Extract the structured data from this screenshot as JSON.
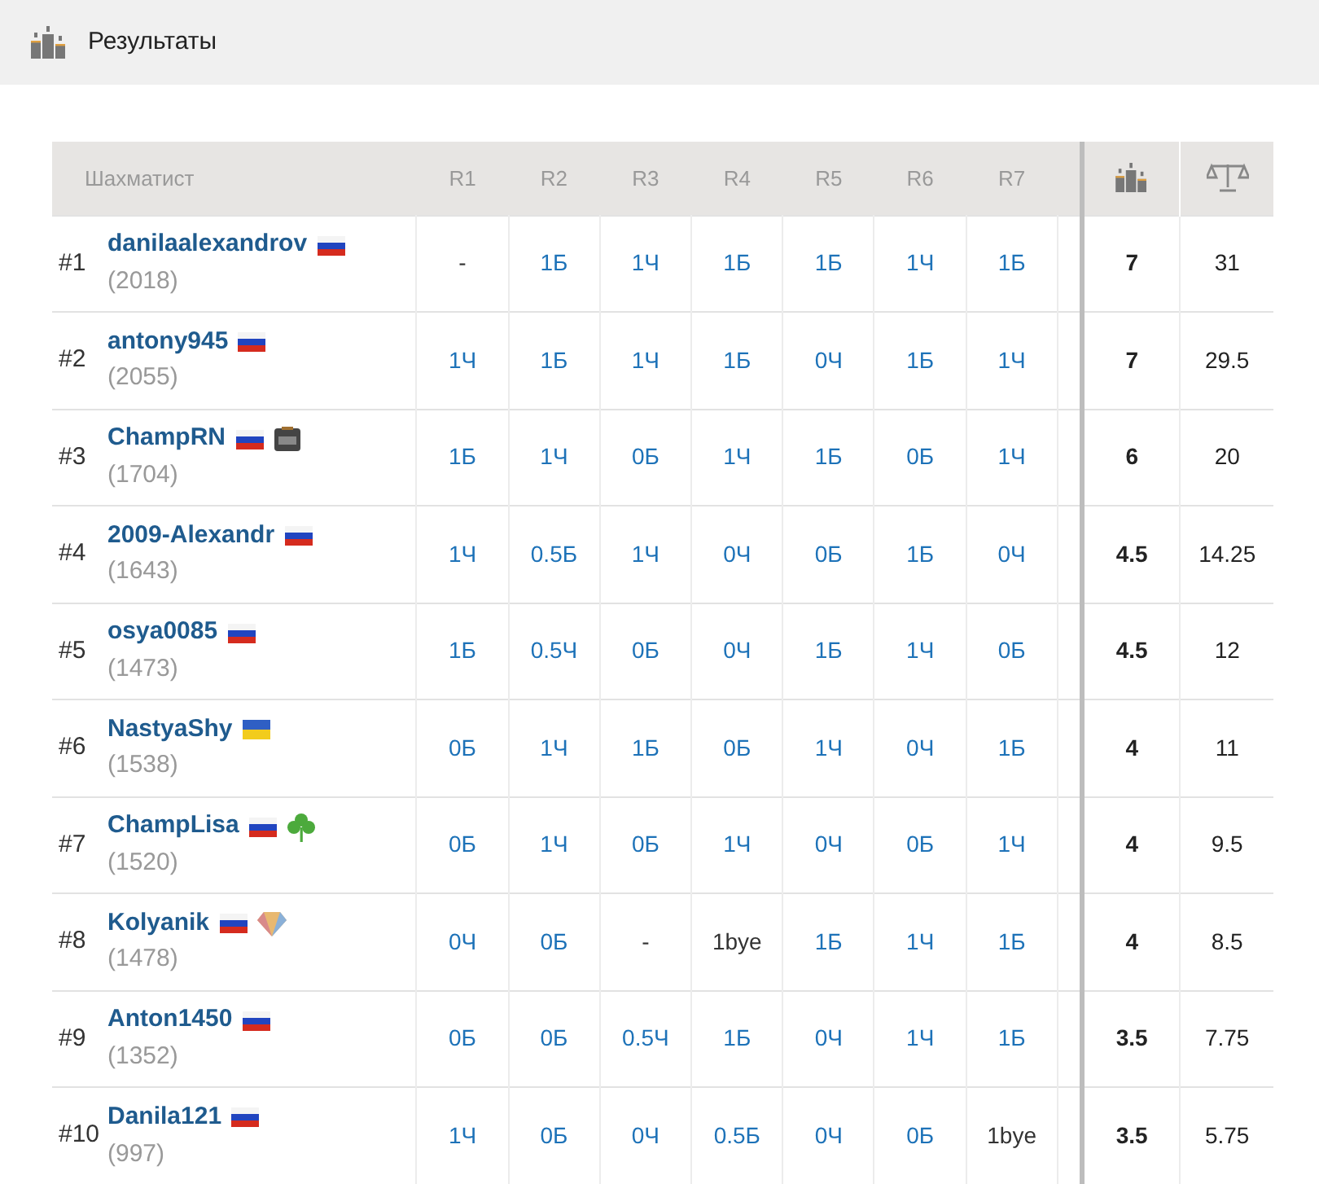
{
  "page_title": "Результаты",
  "table": {
    "columns": [
      "Шахматист",
      "R1",
      "R2",
      "R3",
      "R4",
      "R5",
      "R6",
      "R7"
    ],
    "rows": [
      {
        "rank": "#1",
        "name": "danilaalexandrov",
        "rating": "(2018)",
        "badges": [
          {
            "kind": "flag_ru"
          }
        ],
        "results": [
          {
            "text": "-",
            "kind": "plain"
          },
          {
            "text": "1Б",
            "kind": "link"
          },
          {
            "text": "1Ч",
            "kind": "link"
          },
          {
            "text": "1Б",
            "kind": "link"
          },
          {
            "text": "1Б",
            "kind": "link"
          },
          {
            "text": "1Ч",
            "kind": "link"
          },
          {
            "text": "1Б",
            "kind": "link"
          }
        ],
        "points": "7",
        "tiebreak": "31"
      },
      {
        "rank": "#2",
        "name": "antony945",
        "rating": "(2055)",
        "badges": [
          {
            "kind": "flag_ru"
          }
        ],
        "results": [
          {
            "text": "1Ч",
            "kind": "link"
          },
          {
            "text": "1Б",
            "kind": "link"
          },
          {
            "text": "1Ч",
            "kind": "link"
          },
          {
            "text": "1Б",
            "kind": "link"
          },
          {
            "text": "0Ч",
            "kind": "link"
          },
          {
            "text": "1Б",
            "kind": "link"
          },
          {
            "text": "1Ч",
            "kind": "link"
          }
        ],
        "points": "7",
        "tiebreak": "29.5"
      },
      {
        "rank": "#3",
        "name": "ChampRN",
        "rating": "(1704)",
        "badges": [
          {
            "kind": "flag_ru"
          },
          {
            "kind": "box"
          }
        ],
        "results": [
          {
            "text": "1Б",
            "kind": "link"
          },
          {
            "text": "1Ч",
            "kind": "link"
          },
          {
            "text": "0Б",
            "kind": "link"
          },
          {
            "text": "1Ч",
            "kind": "link"
          },
          {
            "text": "1Б",
            "kind": "link"
          },
          {
            "text": "0Б",
            "kind": "link"
          },
          {
            "text": "1Ч",
            "kind": "link"
          }
        ],
        "points": "6",
        "tiebreak": "20"
      },
      {
        "rank": "#4",
        "name": "2009-Alexandr",
        "rating": "(1643)",
        "badges": [
          {
            "kind": "flag_ru"
          }
        ],
        "results": [
          {
            "text": "1Ч",
            "kind": "link"
          },
          {
            "text": "0.5Б",
            "kind": "link"
          },
          {
            "text": "1Ч",
            "kind": "link"
          },
          {
            "text": "0Ч",
            "kind": "link"
          },
          {
            "text": "0Б",
            "kind": "link"
          },
          {
            "text": "1Б",
            "kind": "link"
          },
          {
            "text": "0Ч",
            "kind": "link"
          }
        ],
        "points": "4.5",
        "tiebreak": "14.25"
      },
      {
        "rank": "#5",
        "name": "osya0085",
        "rating": "(1473)",
        "badges": [
          {
            "kind": "flag_ru"
          }
        ],
        "results": [
          {
            "text": "1Б",
            "kind": "link"
          },
          {
            "text": "0.5Ч",
            "kind": "link"
          },
          {
            "text": "0Б",
            "kind": "link"
          },
          {
            "text": "0Ч",
            "kind": "link"
          },
          {
            "text": "1Б",
            "kind": "link"
          },
          {
            "text": "1Ч",
            "kind": "link"
          },
          {
            "text": "0Б",
            "kind": "link"
          }
        ],
        "points": "4.5",
        "tiebreak": "12"
      },
      {
        "rank": "#6",
        "name": "NastyaShy",
        "rating": "(1538)",
        "badges": [
          {
            "kind": "flag_ua"
          }
        ],
        "results": [
          {
            "text": "0Б",
            "kind": "link"
          },
          {
            "text": "1Ч",
            "kind": "link"
          },
          {
            "text": "1Б",
            "kind": "link"
          },
          {
            "text": "0Б",
            "kind": "link"
          },
          {
            "text": "1Ч",
            "kind": "link"
          },
          {
            "text": "0Ч",
            "kind": "link"
          },
          {
            "text": "1Б",
            "kind": "link"
          }
        ],
        "points": "4",
        "tiebreak": "11"
      },
      {
        "rank": "#7",
        "name": "ChampLisa",
        "rating": "(1520)",
        "badges": [
          {
            "kind": "flag_ru"
          },
          {
            "kind": "clover"
          }
        ],
        "results": [
          {
            "text": "0Б",
            "kind": "link"
          },
          {
            "text": "1Ч",
            "kind": "link"
          },
          {
            "text": "0Б",
            "kind": "link"
          },
          {
            "text": "1Ч",
            "kind": "link"
          },
          {
            "text": "0Ч",
            "kind": "link"
          },
          {
            "text": "0Б",
            "kind": "link"
          },
          {
            "text": "1Ч",
            "kind": "link"
          }
        ],
        "points": "4",
        "tiebreak": "9.5"
      },
      {
        "rank": "#8",
        "name": "Kolyanik",
        "rating": "(1478)",
        "badges": [
          {
            "kind": "flag_ru"
          },
          {
            "kind": "gem"
          }
        ],
        "results": [
          {
            "text": "0Ч",
            "kind": "link"
          },
          {
            "text": "0Б",
            "kind": "link"
          },
          {
            "text": "-",
            "kind": "plain"
          },
          {
            "text": "1bye",
            "kind": "plain"
          },
          {
            "text": "1Б",
            "kind": "link"
          },
          {
            "text": "1Ч",
            "kind": "link"
          },
          {
            "text": "1Б",
            "kind": "link"
          }
        ],
        "points": "4",
        "tiebreak": "8.5"
      },
      {
        "rank": "#9",
        "name": "Anton1450",
        "rating": "(1352)",
        "badges": [
          {
            "kind": "flag_ru"
          }
        ],
        "results": [
          {
            "text": "0Б",
            "kind": "link"
          },
          {
            "text": "0Б",
            "kind": "link"
          },
          {
            "text": "0.5Ч",
            "kind": "link"
          },
          {
            "text": "1Б",
            "kind": "link"
          },
          {
            "text": "0Ч",
            "kind": "link"
          },
          {
            "text": "1Ч",
            "kind": "link"
          },
          {
            "text": "1Б",
            "kind": "link"
          }
        ],
        "points": "3.5",
        "tiebreak": "7.75"
      },
      {
        "rank": "#10",
        "name": "Danila121",
        "rating": "(997)",
        "badges": [
          {
            "kind": "flag_ru"
          }
        ],
        "results": [
          {
            "text": "1Ч",
            "kind": "link"
          },
          {
            "text": "0Б",
            "kind": "link"
          },
          {
            "text": "0Ч",
            "kind": "link"
          },
          {
            "text": "0.5Б",
            "kind": "link"
          },
          {
            "text": "0Ч",
            "kind": "link"
          },
          {
            "text": "0Б",
            "kind": "link"
          },
          {
            "text": "1bye",
            "kind": "plain"
          }
        ],
        "points": "3.5",
        "tiebreak": "5.75"
      }
    ]
  }
}
